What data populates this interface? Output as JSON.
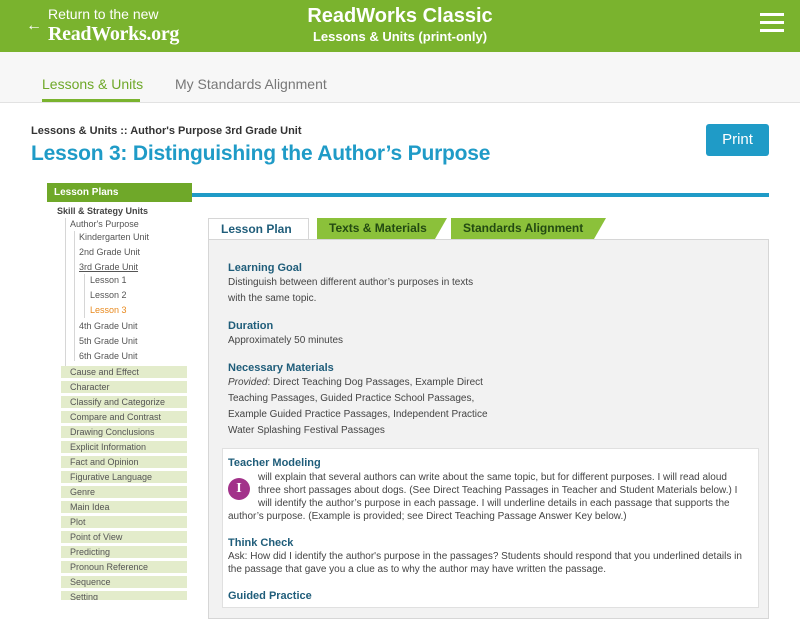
{
  "header": {
    "back_line1": "Return to the new",
    "back_line2": "ReadWorks.org",
    "back_arrow": "←",
    "title": "ReadWorks Classic",
    "subtitle": "Lessons & Units (print-only)"
  },
  "nav": {
    "tabs": [
      "Lessons & Units",
      "My Standards Alignment"
    ]
  },
  "page": {
    "breadcrumb": "Lessons & Units :: Author's Purpose 3rd Grade Unit",
    "title": "Lesson 3: Distinguishing the Author’s Purpose",
    "print_label": "Print"
  },
  "sidebar": {
    "heading": "Lesson Plans",
    "section": "Skill & Strategy Units",
    "unit": "Author's Purpose",
    "grades": [
      "Kindergarten Unit",
      "2nd Grade Unit",
      "3rd Grade Unit"
    ],
    "lessons": [
      "Lesson 1",
      "Lesson 2",
      "Lesson 3"
    ],
    "grades_after": [
      "4th Grade Unit",
      "5th Grade Unit",
      "6th Grade Unit"
    ],
    "skills": [
      "Cause and Effect",
      "Character",
      "Classify and Categorize",
      "Compare and Contrast",
      "Drawing Conclusions",
      "Explicit Information",
      "Fact and Opinion",
      "Figurative Language",
      "Genre",
      "Main Idea",
      "Plot",
      "Point of View",
      "Predicting",
      "Pronoun Reference",
      "Sequence",
      "Setting"
    ]
  },
  "content_tabs": [
    "Lesson Plan",
    "Texts & Materials",
    "Standards Alignment"
  ],
  "lesson": {
    "goal_heading": "Learning Goal",
    "goal_lines": [
      "Distinguish between different author’s purposes in texts",
      "with the same topic."
    ],
    "duration_heading": "Duration",
    "duration_text": "Approximately 50 minutes",
    "materials_heading": "Necessary Materials",
    "materials_provided": "Provided",
    "materials_lines": [
      ": Direct Teaching Dog Passages, Example Direct",
      "Teaching Passages, Guided Practice School Passages,",
      "Example Guided Practice Passages, Independent Practice",
      "Water Splashing Festival Passages"
    ],
    "modeling_heading": "Teacher Modeling",
    "modeling_badge": "I",
    "modeling_lines": [
      "will explain that several authors can write about the same topic, but for different purposes. I will read aloud",
      "three short passages about dogs. (See Direct Teaching Passages in Teacher and Student Materials below.) I",
      "will identify the author’s purpose in each passage. I will underline details in each passage that supports the",
      "author’s purpose. (Example is provided; see Direct Teaching Passage Answer Key below.)"
    ],
    "think_heading": "Think Check",
    "think_lines": [
      "Ask: How did I identify the author's purpose in the passages? Students should respond that you underlined details in",
      "the passage that gave you a clue as to why the author may have written the passage."
    ],
    "guided_heading": "Guided Practice"
  }
}
